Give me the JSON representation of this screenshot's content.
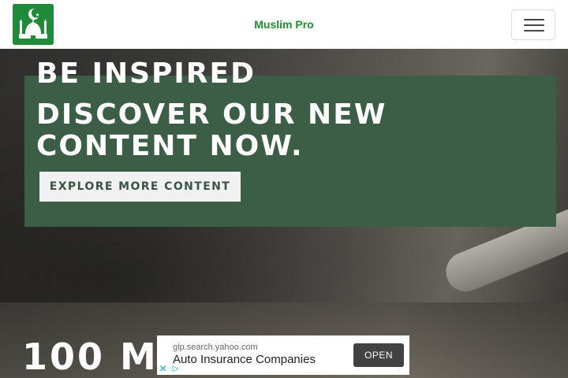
{
  "navbar": {
    "brand": "Muslim Pro"
  },
  "hero": {
    "headline_1": "BE INSPIRED",
    "headline_2": "DISCOVER OUR NEW CONTENT NOW.",
    "cta_label": "EXPLORE MORE CONTENT"
  },
  "section2": {
    "heading_visible": "100 MI"
  },
  "ad": {
    "domain": "glp.search.yahoo.com",
    "title": "Auto Insurance Companies",
    "open_label": "OPEN",
    "close_glyph": "✕",
    "choices_glyph": "▷"
  },
  "colors": {
    "brand_green": "#1e8f2f",
    "hero_box": "#3c5e47",
    "logo_bg": "#1f8a3a"
  },
  "icons": {
    "logo": "mosque-icon",
    "menu": "hamburger-icon"
  }
}
